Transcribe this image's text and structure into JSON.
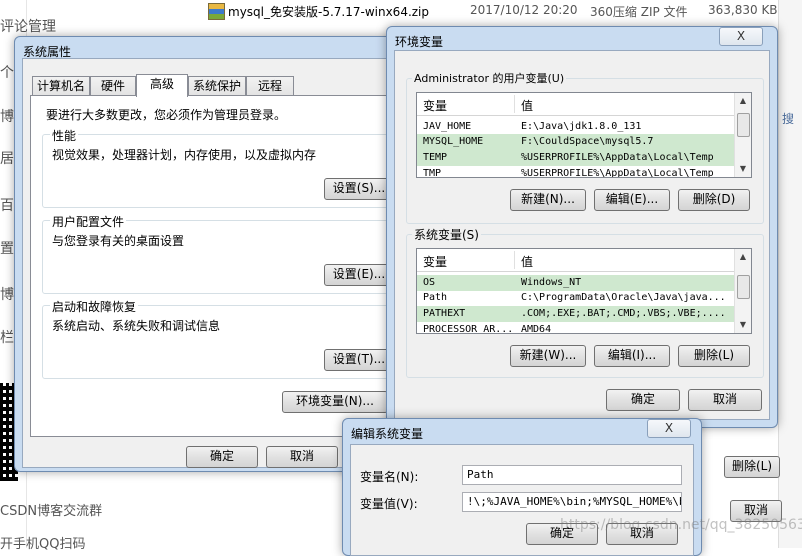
{
  "background": {
    "left_texts": [
      "评论管理",
      "个",
      "博",
      "居",
      "百",
      "置",
      "博",
      "栏"
    ],
    "bottom_texts": [
      "CSDN博客交流群",
      "开手机QQ扫码"
    ],
    "explorer_file": {
      "name": "mysql_免安装版-5.7.17-winx64.zip",
      "date": "2017/10/12 20:20",
      "type": "360压缩 ZIP 文件",
      "size": "363,830 KB"
    },
    "right_texts": [
      "搜",
      "删除(L)",
      "取消"
    ],
    "watermark": "https://blog.csdn.net/qq_38250563"
  },
  "sysprops": {
    "title": "系统属性",
    "tabs": [
      {
        "label": "计算机名",
        "active": false
      },
      {
        "label": "硬件",
        "active": false
      },
      {
        "label": "高级",
        "active": true
      },
      {
        "label": "系统保护",
        "active": false
      },
      {
        "label": "远程",
        "active": false
      }
    ],
    "admin_notice": "要进行大多数更改，您必须作为管理员登录。",
    "performance": {
      "label": "性能",
      "desc": "视觉效果，处理器计划，内存使用，以及虚拟内存",
      "button": "设置(S)..."
    },
    "user_profiles": {
      "label": "用户配置文件",
      "desc": "与您登录有关的桌面设置",
      "button": "设置(E)..."
    },
    "startup": {
      "label": "启动和故障恢复",
      "desc": "系统启动、系统失败和调试信息",
      "button": "设置(T)..."
    },
    "env_button": "环境变量(N)...",
    "ok": "确定",
    "cancel": "取消"
  },
  "envvars": {
    "title": "环境变量",
    "close": "X",
    "user_group": "Administrator 的用户变量(U)",
    "system_group": "系统变量(S)",
    "col_var": "变量",
    "col_val": "值",
    "user_rows": [
      {
        "var": "JAV_HOME",
        "val": "E:\\Java\\jdk1.8.0_131",
        "sel": false
      },
      {
        "var": "MYSQL_HOME",
        "val": "F:\\CouldSpace\\mysql5.7",
        "sel": true
      },
      {
        "var": "TEMP",
        "val": "%USERPROFILE%\\AppData\\Local\\Temp",
        "sel": true
      },
      {
        "var": "TMP",
        "val": "%USERPROFILE%\\AppData\\Local\\Temp",
        "sel": false
      }
    ],
    "system_rows": [
      {
        "var": "OS",
        "val": "Windows_NT",
        "sel": true
      },
      {
        "var": "Path",
        "val": "C:\\ProgramData\\Oracle\\Java\\java...",
        "sel": false
      },
      {
        "var": "PATHEXT",
        "val": ".COM;.EXE;.BAT;.CMD;.VBS;.VBE;....",
        "sel": true
      },
      {
        "var": "PROCESSOR_AR...",
        "val": "AMD64",
        "sel": false
      }
    ],
    "new": "新建(N)...",
    "edit": "编辑(E)...",
    "delete": "删除(D)",
    "new_sys": "新建(W)...",
    "edit_sys": "编辑(I)...",
    "delete_sys": "删除(L)",
    "ok": "确定",
    "cancel": "取消"
  },
  "editvar": {
    "title": "编辑系统变量",
    "close": "X",
    "name_label": "变量名(N):",
    "name_value": "Path",
    "value_label": "变量值(V):",
    "value_value": "!\\;%JAVA_HOME%\\bin;%MYSQL_HOME%\\bin;",
    "ok": "确定",
    "cancel": "取消"
  }
}
